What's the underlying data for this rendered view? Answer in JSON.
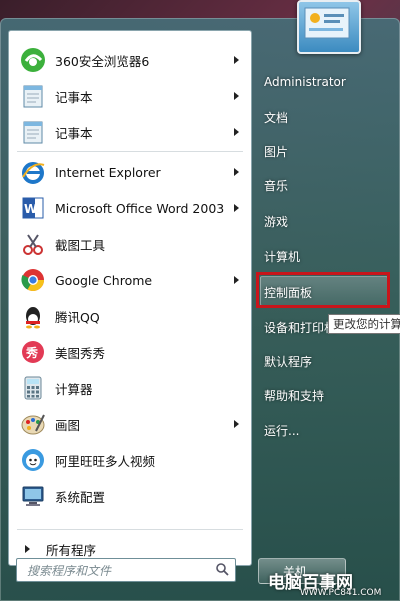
{
  "left_panel": {
    "items": [
      {
        "label": "360安全浏览器6",
        "icon": "360-browser-icon",
        "has_arrow": true
      },
      {
        "label": "记事本",
        "icon": "notepad-icon",
        "has_arrow": true
      },
      {
        "label": "记事本",
        "icon": "notepad-icon",
        "has_arrow": true
      },
      {
        "label": "Internet Explorer",
        "icon": "internet-explorer-icon",
        "has_arrow": true
      },
      {
        "label": "Microsoft Office Word 2003",
        "icon": "word-icon",
        "has_arrow": true
      },
      {
        "label": "截图工具",
        "icon": "snipping-tool-icon",
        "has_arrow": false
      },
      {
        "label": "Google Chrome",
        "icon": "chrome-icon",
        "has_arrow": true
      },
      {
        "label": "腾讯QQ",
        "icon": "qq-icon",
        "has_arrow": false
      },
      {
        "label": "美图秀秀",
        "icon": "meitu-icon",
        "has_arrow": false
      },
      {
        "label": "计算器",
        "icon": "calculator-icon",
        "has_arrow": false
      },
      {
        "label": "画图",
        "icon": "paint-icon",
        "has_arrow": true
      },
      {
        "label": "阿里旺旺多人视频",
        "icon": "aliwangwang-icon",
        "has_arrow": false
      },
      {
        "label": "系统配置",
        "icon": "system-config-icon",
        "has_arrow": false
      }
    ],
    "all_programs": "所有程序",
    "search_placeholder": "搜索程序和文件"
  },
  "right_panel": {
    "items": [
      "Administrator",
      "文档",
      "图片",
      "音乐",
      "游戏",
      "计算机",
      "控制面板",
      "设备和打印机",
      "默认程序",
      "帮助和支持",
      "运行..."
    ],
    "tooltip": "更改您的计算机",
    "shutdown_label": "关机"
  },
  "watermark": {
    "text": "电脑百事网",
    "url": "WWW.PC841.COM"
  },
  "colors": {
    "highlight_border": "#c8151b",
    "panel_bg": "#ffffff"
  }
}
